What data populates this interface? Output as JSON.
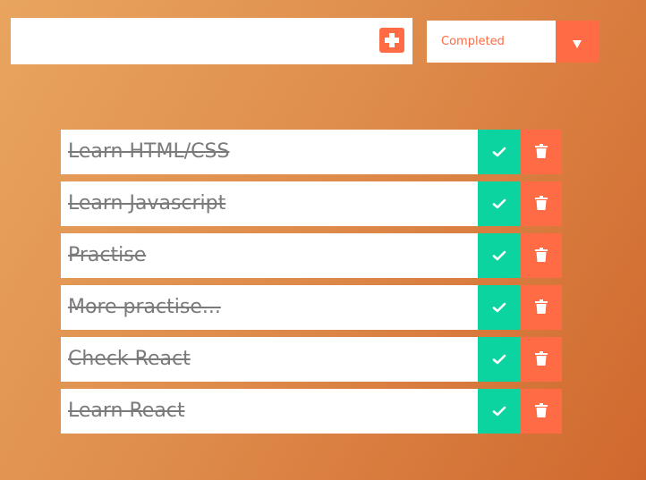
{
  "form": {
    "input_value": "",
    "input_placeholder": "",
    "add_icon": "plus-square-icon",
    "accent_color": "#fe6b45"
  },
  "filter": {
    "selected": "Completed",
    "arrow_icon": "caret-down-icon"
  },
  "todos": [
    {
      "text": "Learn HTML/CSS",
      "completed": true
    },
    {
      "text": "Learn Javascript",
      "completed": true
    },
    {
      "text": "Practise",
      "completed": true
    },
    {
      "text": "More practise...",
      "completed": true
    },
    {
      "text": "Check React",
      "completed": true
    },
    {
      "text": "Learn React",
      "completed": true
    }
  ],
  "actions": {
    "complete_icon": "check-icon",
    "delete_icon": "trash-icon",
    "complete_color": "#0bd4a1",
    "delete_color": "#fe6b45"
  }
}
